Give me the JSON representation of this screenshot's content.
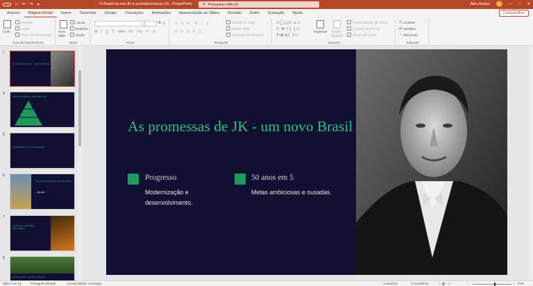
{
  "titlebar": {
    "save_label": "Salvamento Automático",
    "doc_title": "O-Brasil-na-era-JK-e-a-modernizacao (3) - PowerPoint",
    "search_placeholder": "Pesquisar (Alt+Q)",
    "user_name": "Alex Araújo",
    "avatar_initials": "AA"
  },
  "menu": {
    "items": [
      "Arquivo",
      "Página Inicial",
      "Inserir",
      "Desenhar",
      "Design",
      "Transições",
      "Animações",
      "Apresentação de Slides",
      "Revisão",
      "Exibir",
      "Gravação",
      "Ajuda"
    ],
    "active_index": 1,
    "share_label": "Compartilhar"
  },
  "ribbon": {
    "clipboard": {
      "label": "Área de Transferência",
      "paste": "Colar",
      "cut": "Recortar",
      "copy": "Copiar",
      "format_painter": "Pincel de Formatação"
    },
    "slides": {
      "label": "Slides",
      "new_slide_1": "Novo",
      "new_slide_2": "Slide",
      "layout": "Layout",
      "reset": "Redefinir",
      "section": "Seção"
    },
    "font": {
      "label": "Fonte"
    },
    "paragraph": {
      "label": "Parágrafo",
      "text_direction": "Direção do Texto",
      "align_text": "Alinhar Texto",
      "smartart": "Converter em SmartArt"
    },
    "drawing": {
      "label": "Desenho",
      "arrange": "Organizar",
      "quick_styles_1": "Estilos",
      "quick_styles_2": "Rápidos",
      "fill": "Preenchimento da Forma",
      "outline": "Contorno da Forma",
      "effects": "Efeitos de Forma"
    },
    "editing": {
      "label": "Editando",
      "find": "Localizar",
      "replace": "Substituir",
      "select": "Selecionar"
    }
  },
  "thumbnails": [
    {
      "num": "1",
      "title": "As promessas de JK - um novo Brasil"
    },
    {
      "num": "4",
      "title": "O Plano de Metas: visão ambiciosa"
    },
    {
      "num": "5",
      "title": "Investimentos no setor industrial"
    },
    {
      "num": "6",
      "title": "Expansão da indústria automobilística",
      "stat": "300.000"
    },
    {
      "num": "7",
      "title": "Avanços na siderurgia e petroquímica"
    },
    {
      "num": "8",
      "title": "Infraestrutura: rodovias e energia"
    }
  ],
  "slide": {
    "title": "As promessas de JK - um novo Brasil",
    "bullets": [
      {
        "heading": "Progresso",
        "text": "Modernização e desenvolvimento."
      },
      {
        "heading": "50 anos em 5",
        "text": "Metas ambiciosas e ousadas."
      }
    ],
    "accent_color": "#2ec27e",
    "background_color": "#0f1033"
  },
  "status": {
    "slide_count": "Slide 3 de 23",
    "language": "Português (Brasil)",
    "accessibility": "Acessibilidade: investigar",
    "notes": "Anotações",
    "comments": "Comentários",
    "zoom": "94%"
  }
}
